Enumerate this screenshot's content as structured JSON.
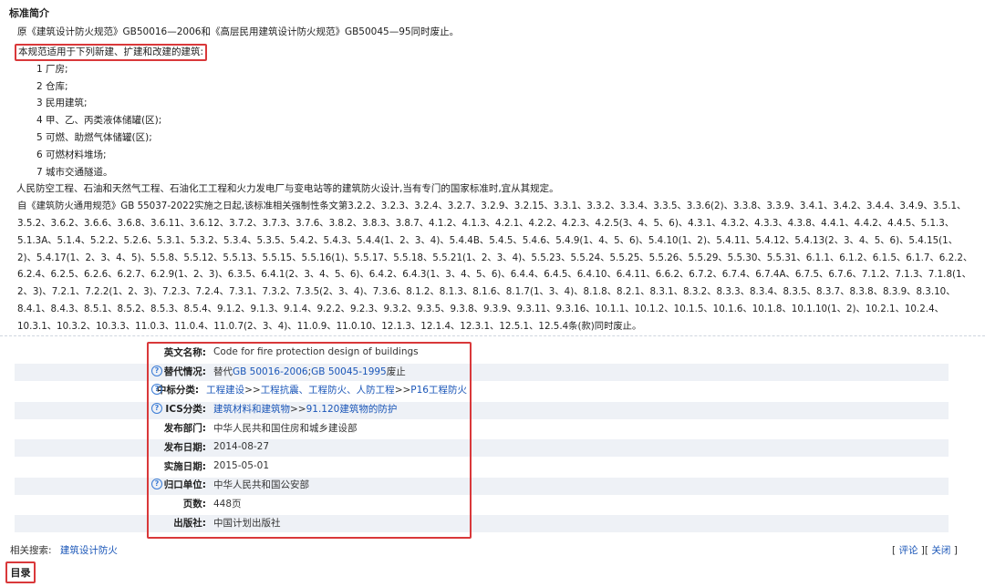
{
  "section_title": "标准简介",
  "intro": {
    "line1": "原《建筑设计防火规范》GB50016—2006和《高层民用建筑设计防火规范》GB50045—95同时废止。",
    "line2": "本规范适用于下列新建、扩建和改建的建筑:",
    "items": [
      "1 厂房;",
      "2 仓库;",
      "3 民用建筑;",
      "4 甲、乙、丙类液体储罐(区);",
      "5 可燃、助燃气体储罐(区);",
      "6 可燃材料堆场;",
      "7 城市交通隧道。"
    ],
    "line3": "人民防空工程、石油和天然气工程、石油化工工程和火力发电厂与变电站等的建筑防火设计,当有专门的国家标准时,宜从其规定。",
    "long": "自《建筑防火通用规范》GB 55037-2022实施之日起,该标准相关强制性条文第3.2.2、3.2.3、3.2.4、3.2.7、3.2.9、3.2.15、3.3.1、3.3.2、3.3.4、3.3.5、3.3.6(2)、3.3.8、3.3.9、3.4.1、3.4.2、3.4.4、3.4.9、3.5.1、3.5.2、3.6.2、3.6.6、3.6.8、3.6.11、3.6.12、3.7.2、3.7.3、3.7.6、3.8.2、3.8.3、3.8.7、4.1.2、4.1.3、4.2.1、4.2.2、4.2.3、4.2.5(3、4、5、6)、4.3.1、4.3.2、4.3.3、4.3.8、4.4.1、4.4.2、4.4.5、5.1.3、5.1.3A、5.1.4、5.2.2、5.2.6、5.3.1、5.3.2、5.3.4、5.3.5、5.4.2、5.4.3、5.4.4(1、2、3、4)、5.4.4B、5.4.5、5.4.6、5.4.9(1、4、5、6)、5.4.10(1、2)、5.4.11、5.4.12、5.4.13(2、3、4、5、6)、5.4.15(1、2)、5.4.17(1、2、3、4、5)、5.5.8、5.5.12、5.5.13、5.5.15、5.5.16(1)、5.5.17、5.5.18、5.5.21(1、2、3、4)、5.5.23、5.5.24、5.5.25、5.5.26、5.5.29、5.5.30、5.5.31、6.1.1、6.1.2、6.1.5、6.1.7、6.2.2、6.2.4、6.2.5、6.2.6、6.2.7、6.2.9(1、2、3)、6.3.5、6.4.1(2、3、4、5、6)、6.4.2、6.4.3(1、3、4、5、6)、6.4.4、6.4.5、6.4.10、6.4.11、6.6.2、6.7.2、6.7.4、6.7.4A、6.7.5、6.7.6、7.1.2、7.1.3、7.1.8(1、2、3)、7.2.1、7.2.2(1、2、3)、7.2.3、7.2.4、7.3.1、7.3.2、7.3.5(2、3、4)、7.3.6、8.1.2、8.1.3、8.1.6、8.1.7(1、3、4)、8.1.8、8.2.1、8.3.1、8.3.2、8.3.3、8.3.4、8.3.5、8.3.7、8.3.8、8.3.9、8.3.10、8.4.1、8.4.3、8.5.1、8.5.2、8.5.3、8.5.4、9.1.2、9.1.3、9.1.4、9.2.2、9.2.3、9.3.2、9.3.5、9.3.8、9.3.9、9.3.11、9.3.16、10.1.1、10.1.2、10.1.5、10.1.6、10.1.8、10.1.10(1、2)、10.2.1、10.2.4、10.3.1、10.3.2、10.3.3、11.0.3、11.0.4、11.0.7(2、3、4)、11.0.9、11.0.10、12.1.3、12.1.4、12.3.1、12.5.1、12.5.4条(款)同时废止。"
  },
  "info": {
    "english_name": {
      "label": "英文名称:",
      "value": "Code for fire protection design of buildings"
    },
    "replace": {
      "label": "替代情况:",
      "prefix": "替代",
      "link1": "GB 50016-2006",
      "sep": ";",
      "link2": "GB 50045-1995",
      "suffix": "废止"
    },
    "ccs": {
      "label": "中标分类:",
      "link1": "工程建设",
      "sep1": ">>",
      "link2": "工程抗震、工程防火、人防工程",
      "sep2": ">>",
      "link3": "P16工程防火"
    },
    "ics": {
      "label": "ICS分类:",
      "link1": "建筑材料和建筑物",
      "sep1": ">>",
      "link2": "91.120建筑物的防护"
    },
    "publisher_dept": {
      "label": "发布部门:",
      "value": "中华人民共和国住房和城乡建设部"
    },
    "publish_date": {
      "label": "发布日期:",
      "value": "2014-08-27"
    },
    "implement_date": {
      "label": "实施日期:",
      "value": "2015-05-01"
    },
    "owner": {
      "label": "归口单位:",
      "value": "中华人民共和国公安部"
    },
    "pages": {
      "label": "页数:",
      "value": "448页"
    },
    "press": {
      "label": "出版社:",
      "value": "中国计划出版社"
    }
  },
  "related": {
    "label": "相关搜索:",
    "link": "建筑设计防火"
  },
  "actions": {
    "open1": "[",
    "comment": "评论",
    "mid": "][",
    "close_link": "关闭",
    "close1": "]"
  },
  "toc_title": "目录",
  "colors": {
    "highlight": "#d9383a",
    "link": "#1a56b8",
    "stripe": "#eef1f6"
  }
}
